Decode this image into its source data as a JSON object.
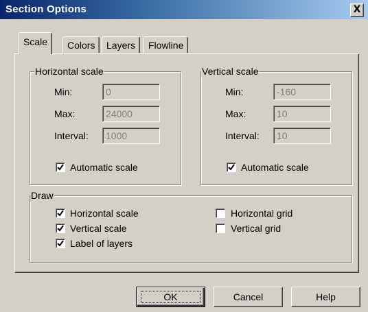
{
  "window": {
    "title": "Section Options",
    "close_symbol": "X"
  },
  "tabs": [
    {
      "label": "Scale",
      "active": true
    },
    {
      "label": "Colors",
      "active": false
    },
    {
      "label": "Layers",
      "active": false
    },
    {
      "label": "Flowline",
      "active": false
    }
  ],
  "horizontal_scale": {
    "legend": "Horizontal scale",
    "min_label": "Min:",
    "min_value": "0",
    "max_label": "Max:",
    "max_value": "24000",
    "interval_label": "Interval:",
    "interval_value": "1000",
    "auto_label": "Automatic scale",
    "auto_checked": true
  },
  "vertical_scale": {
    "legend": "Vertical scale",
    "min_label": "Min:",
    "min_value": "-160",
    "max_label": "Max:",
    "max_value": "10",
    "interval_label": "Interval:",
    "interval_value": "10",
    "auto_label": "Automatic scale",
    "auto_checked": true
  },
  "draw": {
    "legend": "Draw",
    "items": [
      {
        "label": "Horizontal scale",
        "checked": true
      },
      {
        "label": "Vertical scale",
        "checked": true
      },
      {
        "label": "Label of layers",
        "checked": true
      },
      {
        "label": "Horizontal grid",
        "checked": false
      },
      {
        "label": "Vertical grid",
        "checked": false
      }
    ]
  },
  "buttons": {
    "ok": "OK",
    "cancel": "Cancel",
    "help": "Help"
  }
}
